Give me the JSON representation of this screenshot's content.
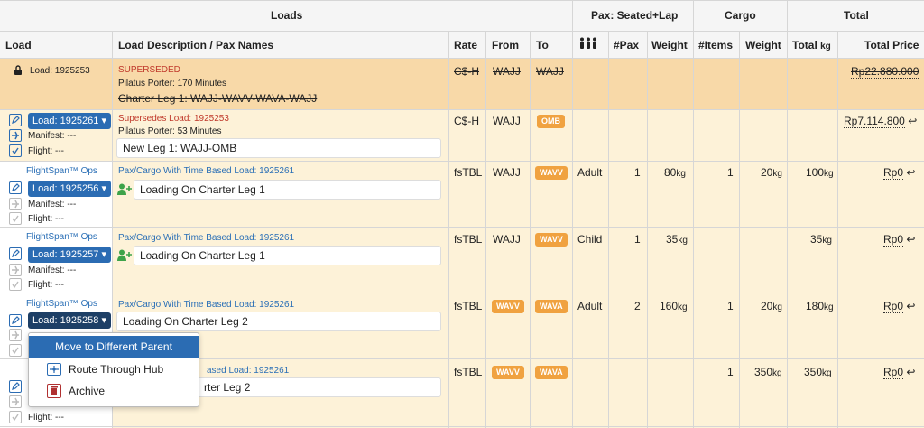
{
  "header": {
    "groups": {
      "loads": "Loads",
      "pax": "Pax: Seated+Lap",
      "cargo": "Cargo",
      "total": "Total"
    },
    "columns": {
      "load": "Load",
      "description": "Load Description / Pax Names",
      "rate": "Rate",
      "from": "From",
      "to": "To",
      "npax": "#Pax",
      "weight": "Weight",
      "nitems": "#Items",
      "cweight": "Weight",
      "total": "Total",
      "total_unit": "kg",
      "price": "Total Price"
    }
  },
  "rows": [
    {
      "load": "Load: 1925253",
      "status": "SUPERSEDED",
      "aircraft": "Pilatus Porter: 170 Minutes",
      "leg": "Charter Leg 1: WAJJ-WAVV-WAVA-WAJJ",
      "rate": "C$-H",
      "from": "WAJJ",
      "to": "WAJJ",
      "price": "Rp22.880.000"
    },
    {
      "load": "Load: 1925261",
      "manifest": "Manifest: ---",
      "flight": "Flight: ---",
      "supersedes": "Supersedes Load: 1925253",
      "aircraft": "Pilatus Porter: 53 Minutes",
      "leg": "New Leg 1: WAJJ-OMB",
      "rate": "C$-H",
      "from": "WAJJ",
      "to": "OMB",
      "price": "Rp7.114.800",
      "return": "↩"
    },
    {
      "ops": "FlightSpan™ Ops",
      "load": "Load: 1925256",
      "manifest": "Manifest: ---",
      "flight": "Flight: ---",
      "link": "Pax/Cargo With Time Based Load: 1925261",
      "leg": "Loading On Charter Leg 1",
      "rate": "fsTBL",
      "from": "WAJJ",
      "to": "WAVV",
      "seat": "Adult",
      "npax": "1",
      "weight": "80",
      "nitems": "1",
      "cweight": "20",
      "total": "100",
      "price": "Rp0",
      "return": "↩"
    },
    {
      "ops": "FlightSpan™ Ops",
      "load": "Load: 1925257",
      "manifest": "Manifest: ---",
      "flight": "Flight: ---",
      "link": "Pax/Cargo With Time Based Load: 1925261",
      "leg": "Loading On Charter Leg 1",
      "rate": "fsTBL",
      "from": "WAJJ",
      "to": "WAVV",
      "seat": "Child",
      "npax": "1",
      "weight": "35",
      "total": "35",
      "price": "Rp0",
      "return": "↩"
    },
    {
      "ops": "FlightSpan™ Ops",
      "load": "Load: 1925258",
      "link": "Pax/Cargo With Time Based Load: 1925261",
      "leg": "Loading On Charter Leg 2",
      "rate": "fsTBL",
      "from": "WAVV",
      "to": "WAVA",
      "seat": "Adult",
      "npax": "2",
      "weight": "160",
      "nitems": "1",
      "cweight": "20",
      "total": "180",
      "price": "Rp0",
      "return": "↩"
    },
    {
      "flight": "Flight: ---",
      "link_tail": "ased Load: 1925261",
      "leg_tail": "rter Leg 2",
      "rate": "fsTBL",
      "from": "WAVV",
      "to": "WAVA",
      "nitems": "1",
      "cweight": "350",
      "total": "350",
      "price": "Rp0",
      "return": "↩"
    }
  ],
  "unit": "kg",
  "caret": "▾",
  "menu": {
    "items": [
      {
        "label": "Move to Different Parent"
      },
      {
        "label": "Route Through Hub"
      },
      {
        "label": "Archive"
      }
    ]
  },
  "colors": {
    "superseded_bg": "#f8d9a8",
    "row_bg": "#fdf2d8",
    "badge": "#f0a240",
    "accent": "#2b6cb3"
  }
}
